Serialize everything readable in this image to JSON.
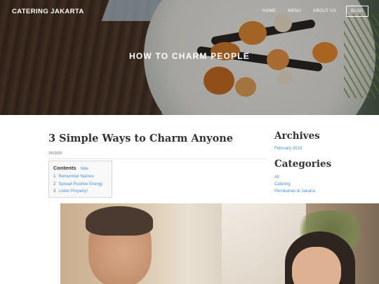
{
  "header": {
    "brand": "CATERING JAKARTA",
    "nav": [
      "HOME",
      "MENU",
      "ABOUT US",
      "BLOG"
    ],
    "hero_title": "HOW TO CHARM PEOPLE"
  },
  "post": {
    "title": "3 Simple Ways to Charm Anyone",
    "date": "2/5/2020",
    "toc": {
      "title": "Contents",
      "hide_label": "hide",
      "items": [
        {
          "num": "1",
          "label": "Remember Names"
        },
        {
          "num": "2",
          "label": "Spread Positive Energy"
        },
        {
          "num": "3",
          "label": "Listen Properly!"
        }
      ]
    }
  },
  "sidebar": {
    "archives_heading": "Archives",
    "archives": [
      "February 2019"
    ],
    "categories_heading": "Categories",
    "categories": [
      "All",
      "Catering",
      "Pernikahan di Jakarta"
    ]
  },
  "colors": {
    "link": "#4a90d9",
    "text": "#333333"
  }
}
